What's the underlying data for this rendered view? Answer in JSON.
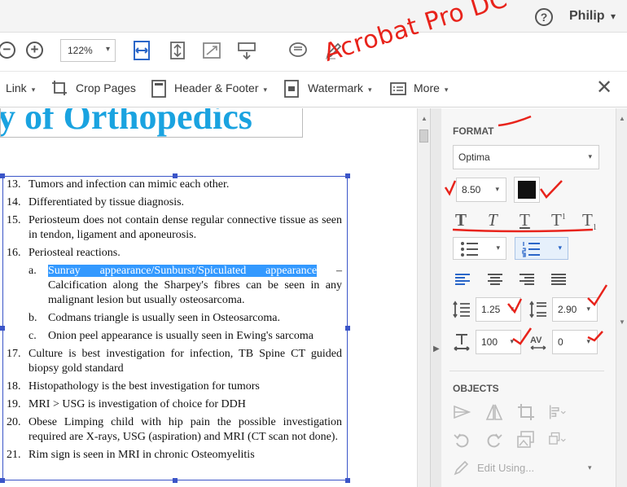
{
  "header": {
    "help_label": "?",
    "user_name": "Philip"
  },
  "toolbar": {
    "zoom_value": "122%"
  },
  "annotation": {
    "text": "Acrobat Pro DC"
  },
  "editbar": {
    "link_label": "Link",
    "crop_pages_label": "Crop Pages",
    "header_footer_label": "Header & Footer",
    "watermark_label": "Watermark",
    "more_label": "More"
  },
  "document": {
    "heading": "y of Orthopedics",
    "items": [
      {
        "num": "13.",
        "text": "Tumors and infection can mimic each other."
      },
      {
        "num": "14.",
        "text": "Differentiated by tissue diagnosis."
      },
      {
        "num": "15.",
        "text": "Periosteum does not contain dense regular connective tissue as seen in tendon, ligament and aponeurosis."
      },
      {
        "num": "16.",
        "text": "Periosteal reactions."
      }
    ],
    "subitems": [
      {
        "num": "a.",
        "highlight": "Sunray appearance/Sunburst/Spiculated appearance",
        "text": " – Calcification along the Sharpey's fibres can be seen in any malignant lesion but usually osteosarcoma."
      },
      {
        "num": "b.",
        "text": "Codmans triangle is usually seen in Osteosarcoma."
      },
      {
        "num": "c.",
        "text": "Onion peel appearance is usually seen in Ewing's sarcoma"
      }
    ],
    "items2": [
      {
        "num": "17.",
        "text": "Culture is best investigation for infection, TB Spine CT guided biopsy gold standard"
      },
      {
        "num": "18.",
        "text": "Histopathology is the best investigation for tumors"
      },
      {
        "num": "19.",
        "text": "MRI > USG is investigation of choice for DDH"
      },
      {
        "num": "20.",
        "text": "Obese Limping child with hip pain the possible investigation required are X-rays, USG (aspiration) and MRI (CT scan not done)."
      },
      {
        "num": "21.",
        "text": "Rim sign is seen in MRI in chronic Osteomyelitis"
      }
    ]
  },
  "panel": {
    "format_title": "FORMAT",
    "font_family": "Optima",
    "font_size": "8.50",
    "line_spacing": "1.25",
    "para_spacing": "2.90",
    "scale": "100",
    "char_spacing": "0",
    "objects_title": "OBJECTS",
    "edit_using": "Edit Using..."
  },
  "colors": {
    "accent_blue": "#1aa3e0",
    "selection": "#3399ff",
    "frame": "#3b55c8",
    "annotation_red": "#e8231b",
    "text_color_swatch": "#111111"
  }
}
